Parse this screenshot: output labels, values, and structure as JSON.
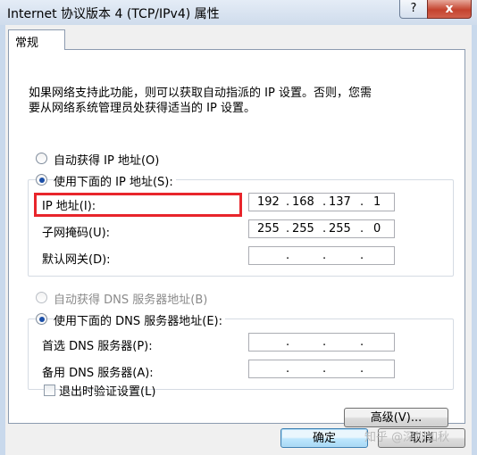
{
  "window": {
    "title": "Internet 协议版本 4 (TCP/IPv4) 属性",
    "help_label": "?",
    "close_label": "x"
  },
  "tab": {
    "label": "常规"
  },
  "description": "如果网络支持此功能，则可以获取自动指派的 IP 设置。否则，您需\n要从网络系统管理员处获得适当的 IP 设置。",
  "ip_mode": {
    "auto_label": "自动获得 IP 地址(O)",
    "manual_label": "使用下面的 IP 地址(S):",
    "selected": "manual"
  },
  "ip_fields": [
    {
      "label": "IP 地址(I):",
      "octets": [
        "192",
        "168",
        "137",
        "1"
      ]
    },
    {
      "label": "子网掩码(U):",
      "octets": [
        "255",
        "255",
        "255",
        "0"
      ]
    },
    {
      "label": "默认网关(D):",
      "octets": [
        "",
        "",
        "",
        ""
      ]
    }
  ],
  "dns_mode": {
    "auto_label": "自动获得 DNS 服务器地址(B)",
    "manual_label": "使用下面的 DNS 服务器地址(E):",
    "selected": "manual"
  },
  "dns_fields": [
    {
      "label": "首选 DNS 服务器(P):",
      "octets": [
        "",
        "",
        "",
        ""
      ]
    },
    {
      "label": "备用 DNS 服务器(A):",
      "octets": [
        "",
        "",
        "",
        ""
      ]
    }
  ],
  "validate": {
    "label": "退出时验证设置(L)",
    "checked": false
  },
  "buttons": {
    "advanced": "高级(V)...",
    "ok": "确定",
    "cancel": "取消"
  },
  "watermark": "知乎 @深圳知秋",
  "colors": {
    "highlight": "#e8252b",
    "radio_fill": "#1b4fa8"
  }
}
